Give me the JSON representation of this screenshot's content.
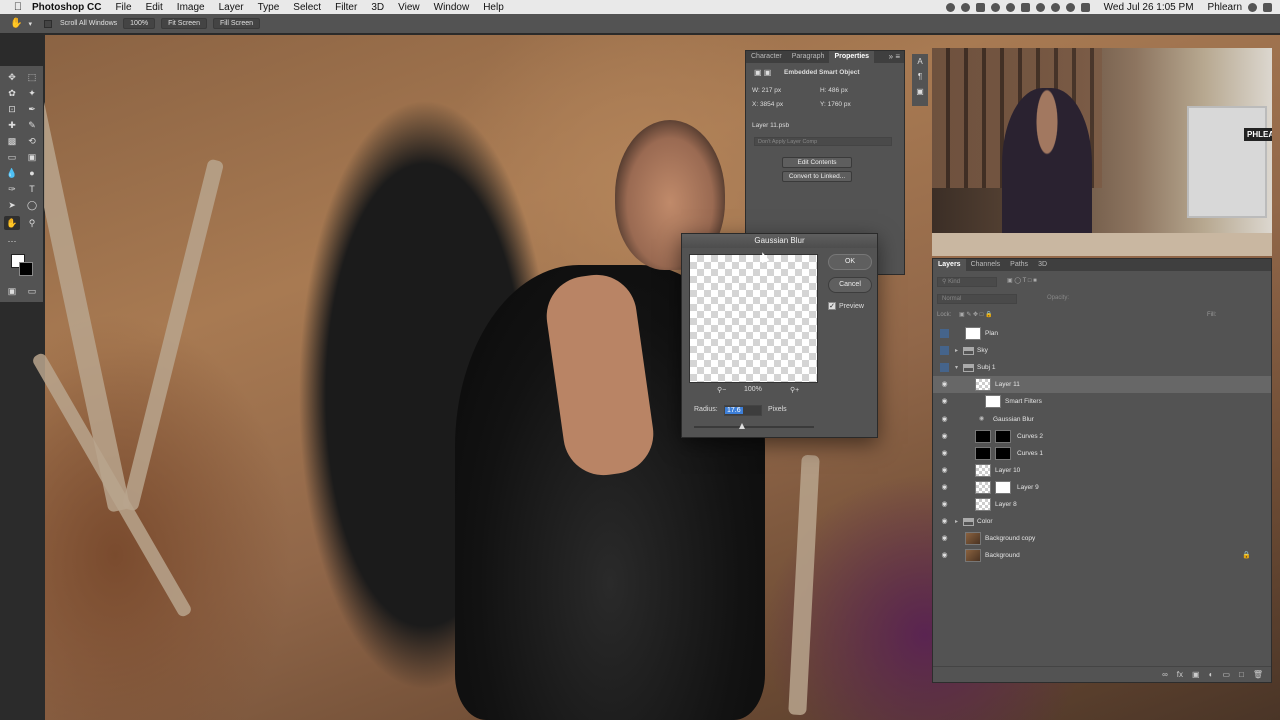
{
  "menubar": {
    "app": "Photoshop CC",
    "menus": [
      "File",
      "Edit",
      "Image",
      "Layer",
      "Type",
      "Select",
      "Filter",
      "3D",
      "View",
      "Window",
      "Help"
    ],
    "clock": "Wed Jul 26  1:05 PM",
    "user": "Phlearn"
  },
  "optionsbar": {
    "scroll_all": "Scroll All Windows",
    "zoom": "100%",
    "fit": "Fit Screen",
    "fill": "Fill Screen"
  },
  "toolbox": {
    "icons": [
      "move-icon",
      "marquee-icon",
      "lasso-icon",
      "magic-wand-icon",
      "crop-icon",
      "eyedropper-icon",
      "healing-icon",
      "brush-icon",
      "stamp-icon",
      "history-brush-icon",
      "eraser-icon",
      "gradient-icon",
      "blur-icon",
      "dodge-icon",
      "pen-icon",
      "type-icon",
      "path-select-icon",
      "shape-icon",
      "hand-icon",
      "zoom-icon"
    ]
  },
  "properties": {
    "tabs": [
      "Character",
      "Paragraph",
      "Properties"
    ],
    "active_tab": "Properties",
    "header": "Embedded Smart Object",
    "w": "W:  217 px",
    "h": "H:  486 px",
    "x": "X:  3854 px",
    "y": "Y:  1760 px",
    "filename": "Layer 11.psb",
    "layer_comp": "Don't Apply Layer Comp",
    "edit_contents": "Edit Contents",
    "convert": "Convert to Linked..."
  },
  "gaussian": {
    "title": "Gaussian Blur",
    "ok": "OK",
    "cancel": "Cancel",
    "preview_label": "Preview",
    "preview_checked": true,
    "zoom": "100%",
    "radius_label": "Radius:",
    "radius_value": "17.6",
    "radius_unit": "Pixels"
  },
  "video": {
    "sign": "PHLEA"
  },
  "layers": {
    "tabs": [
      "Layers",
      "Channels",
      "Paths",
      "3D"
    ],
    "active_tab": "Layers",
    "kind_placeholder": "Kind",
    "blend_mode": "Normal",
    "opacity_label": "Opacity:",
    "lock_label": "Lock:",
    "fill_label": "Fill:",
    "rows": [
      {
        "label": "Plan",
        "visible": false,
        "thumb": "white",
        "selected": false,
        "indent": 0
      },
      {
        "label": "Sky",
        "visible": false,
        "thumb": "folder",
        "selected": false,
        "indent": 0
      },
      {
        "label": "Subj 1",
        "visible": false,
        "thumb": "folder",
        "selected": false,
        "indent": 0
      },
      {
        "label": "Layer 11",
        "visible": true,
        "thumb": "checker",
        "selected": true,
        "indent": 1
      },
      {
        "label": "Smart Filters",
        "visible": true,
        "thumb": "white",
        "selected": false,
        "indent": 2
      },
      {
        "label": "Gaussian Blur",
        "visible": true,
        "thumb": "none",
        "selected": false,
        "indent": 2
      },
      {
        "label": "Curves 2",
        "visible": true,
        "thumb": "black",
        "selected": false,
        "indent": 1
      },
      {
        "label": "Curves 1",
        "visible": true,
        "thumb": "black",
        "selected": false,
        "indent": 1
      },
      {
        "label": "Layer 10",
        "visible": true,
        "thumb": "checker",
        "selected": false,
        "indent": 1
      },
      {
        "label": "Layer 9",
        "visible": true,
        "thumb": "checker",
        "selected": false,
        "indent": 1
      },
      {
        "label": "Layer 8",
        "visible": true,
        "thumb": "checker",
        "selected": false,
        "indent": 1
      },
      {
        "label": "Color",
        "visible": true,
        "thumb": "folder",
        "selected": false,
        "indent": 0
      },
      {
        "label": "Background copy",
        "visible": true,
        "thumb": "photo",
        "selected": false,
        "indent": 0
      },
      {
        "label": "Background",
        "visible": true,
        "thumb": "photo",
        "selected": false,
        "indent": 0
      }
    ]
  }
}
